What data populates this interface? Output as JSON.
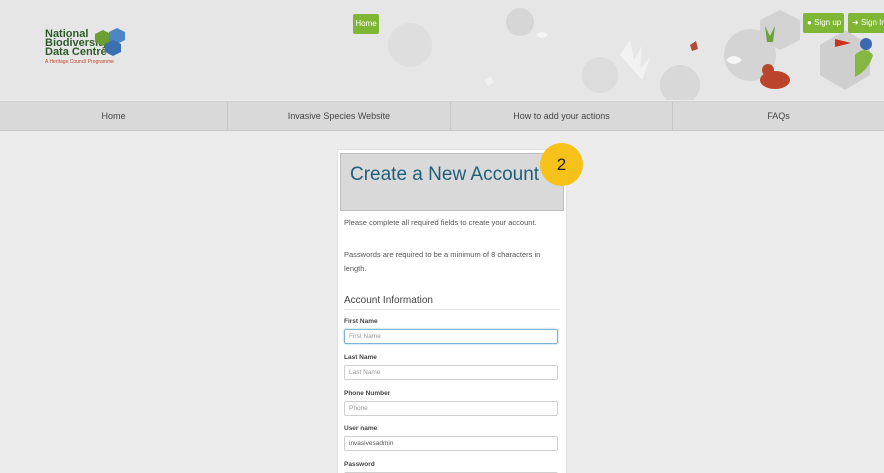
{
  "header": {
    "logo": {
      "line1": "National",
      "line2": "Biodiversity",
      "line3": "Data Centre",
      "tagline": "A Heritage Council Programme"
    },
    "home_button": "Home",
    "signup_button": "Sign up",
    "signin_button": "Sign In"
  },
  "nav": {
    "items": [
      {
        "label": "Home"
      },
      {
        "label": "Invasive Species Website"
      },
      {
        "label": "How to add your actions"
      },
      {
        "label": "FAQs"
      }
    ]
  },
  "form": {
    "title": "Create a New Account",
    "step": "2",
    "info1": "Please complete all required fields to create your account.",
    "info2": "Passwords are required to be a minimum of 8 characters in length.",
    "section": "Account Information",
    "fields": [
      {
        "label": "First Name",
        "placeholder": "First Name",
        "value": ""
      },
      {
        "label": "Last Name",
        "placeholder": "Last Name",
        "value": ""
      },
      {
        "label": "Phone Number",
        "placeholder": "Phone",
        "value": ""
      },
      {
        "label": "User name",
        "placeholder": "",
        "value": "invasivesadmin"
      },
      {
        "label": "Password",
        "placeholder": "",
        "value": ""
      }
    ]
  },
  "colors": {
    "accent_green": "#7fb634",
    "title_blue": "#1f5f7a",
    "badge_yellow": "#f6c21a"
  }
}
